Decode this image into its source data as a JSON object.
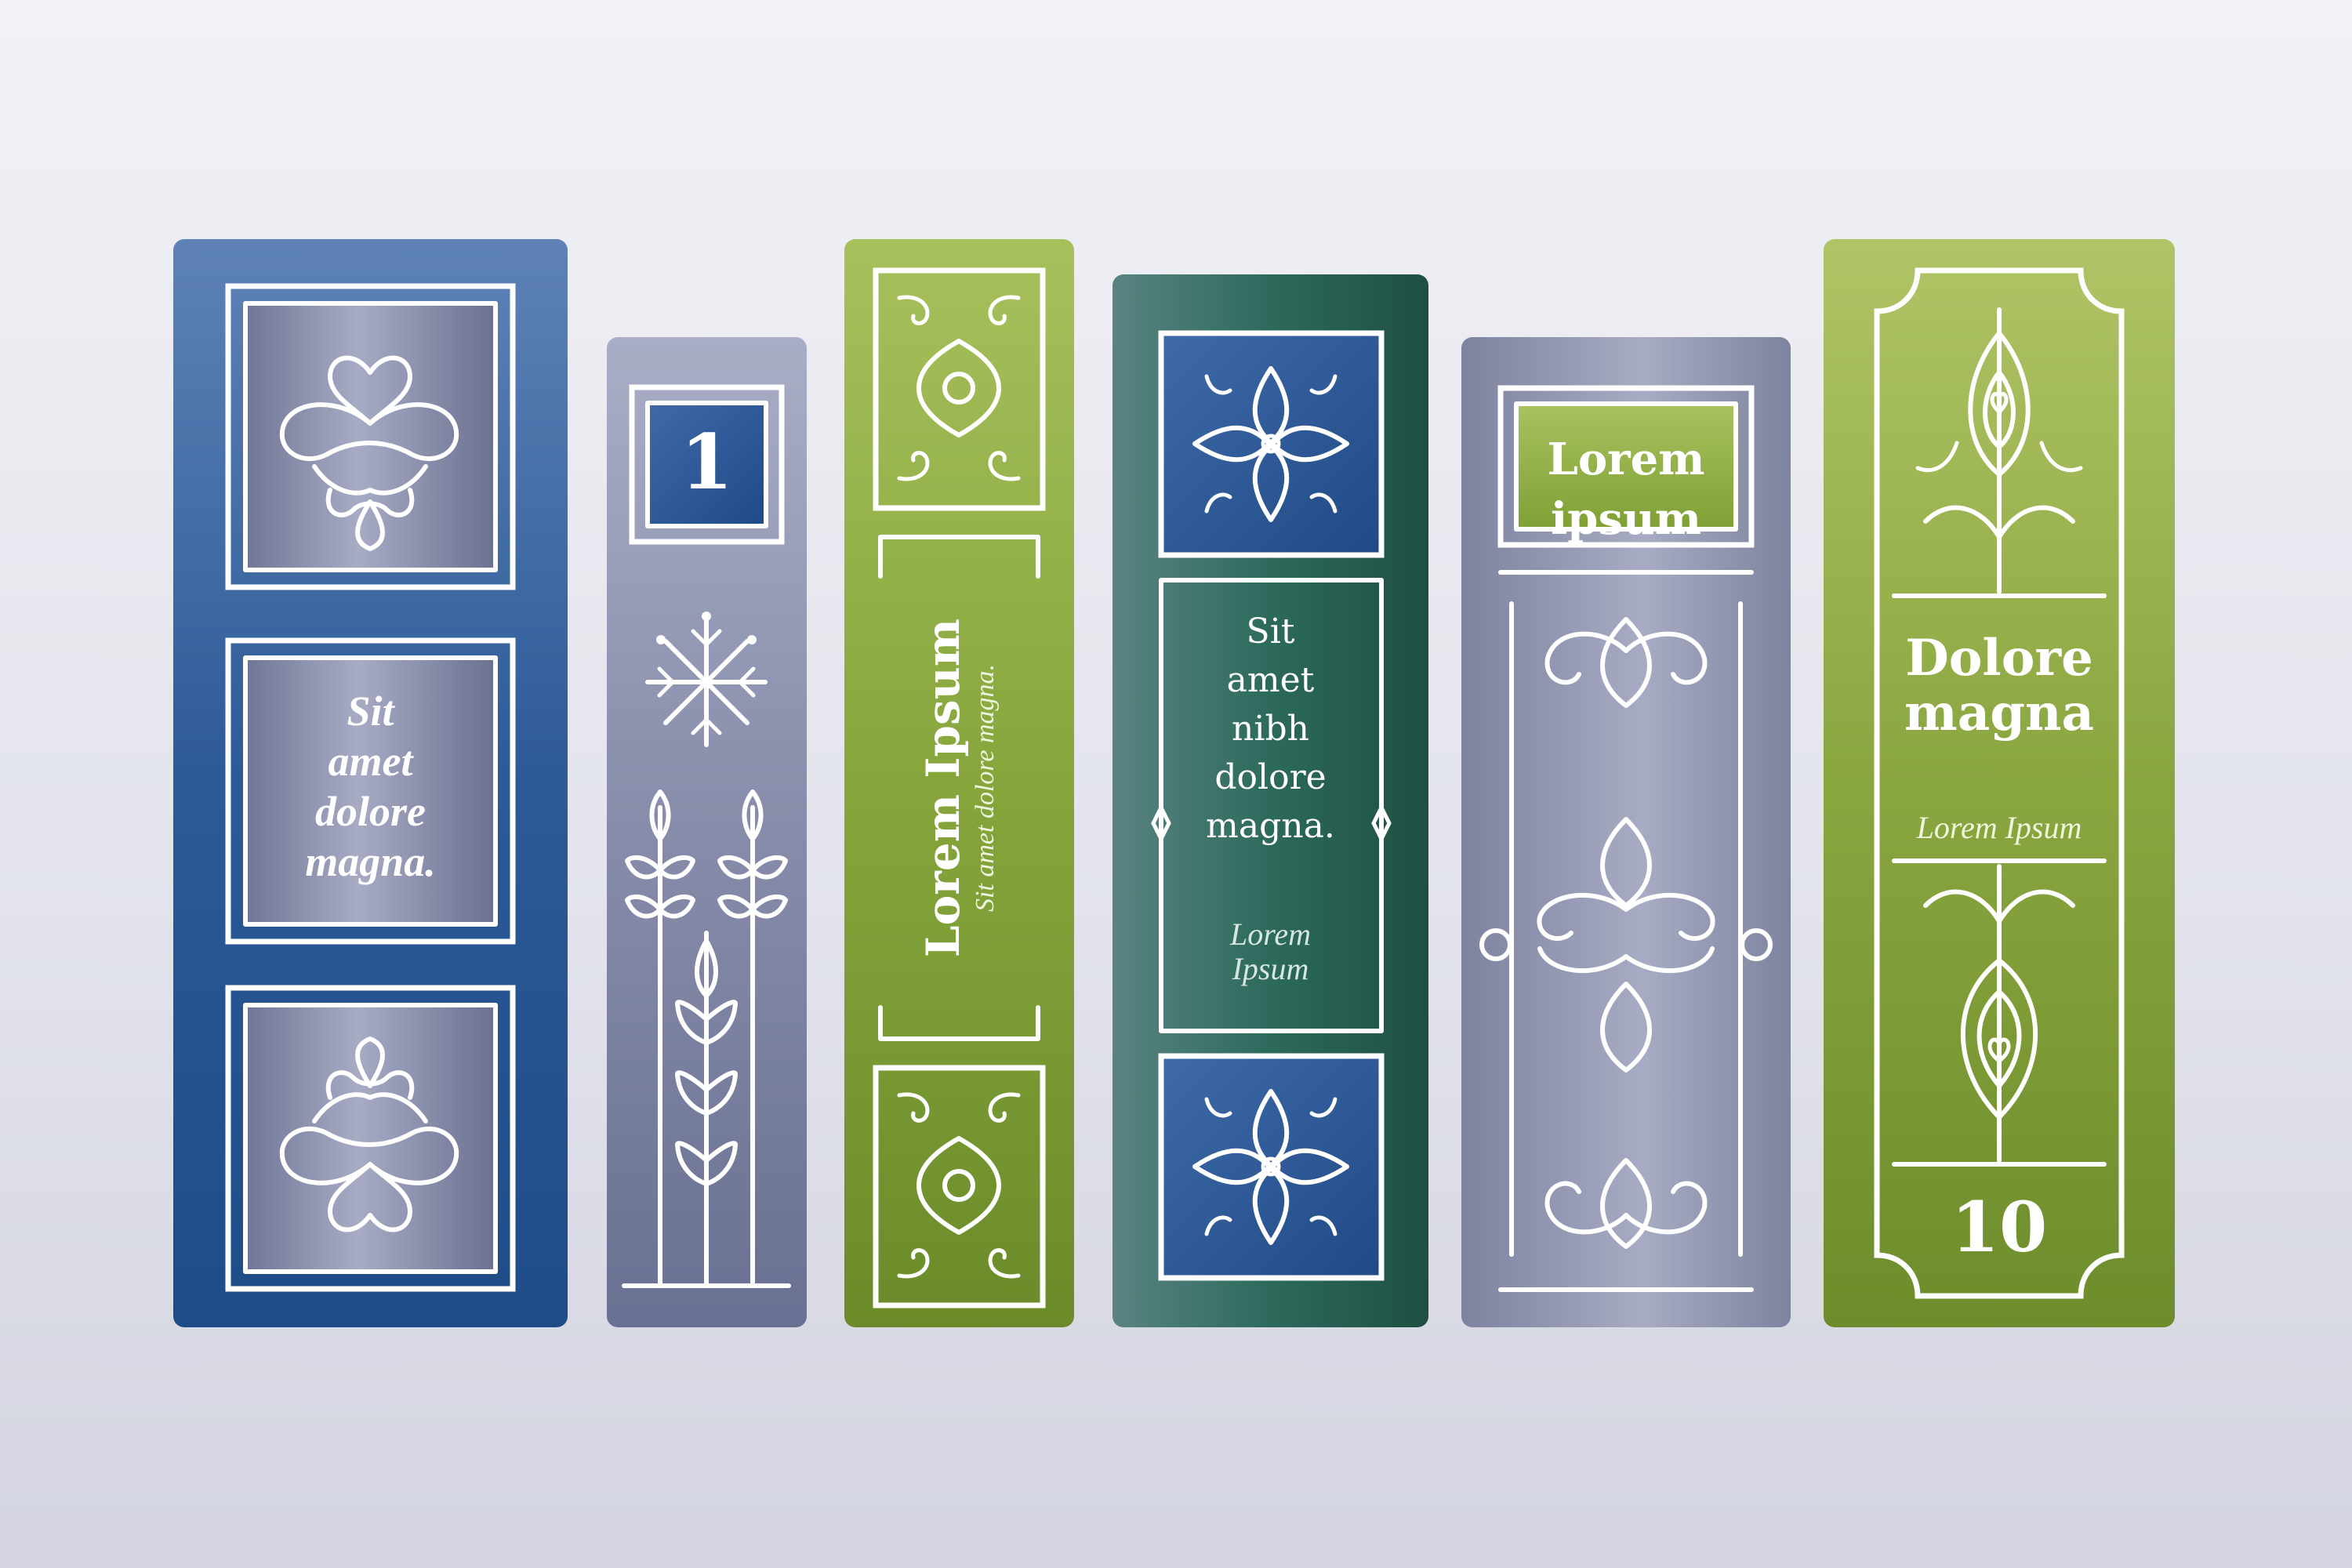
{
  "books": [
    {
      "id": "book-1",
      "label_lines": [
        "Sit",
        "amet",
        "dolore",
        "magna."
      ]
    },
    {
      "id": "book-2",
      "number": "1"
    },
    {
      "id": "book-3",
      "title": "Lorem Ipsum",
      "subtitle": "Sit amet dolore magna."
    },
    {
      "id": "book-4",
      "label_lines": [
        "Sit",
        "amet",
        "nibh",
        "dolore",
        "magna."
      ],
      "sub_lines": [
        "Lorem",
        "Ipsum"
      ]
    },
    {
      "id": "book-5",
      "label_lines": [
        "Lorem",
        "ipsum"
      ]
    },
    {
      "id": "book-6",
      "title_lines": [
        "Dolore",
        "magna"
      ],
      "subtitle": "Lorem Ipsum",
      "number": "10"
    }
  ],
  "colors": {
    "background": "#e6e7ee",
    "blue": "#2c5a97",
    "gray": "#868ca9",
    "green": "#86a63c",
    "teal": "#2c6a5c",
    "ornament": "#ffffff"
  }
}
